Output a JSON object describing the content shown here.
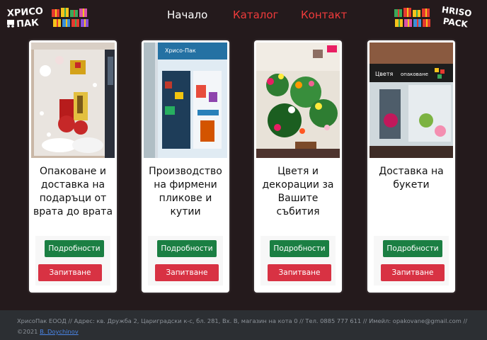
{
  "header": {
    "logo_left_text": [
      "ХРИСО",
      "ПАК"
    ],
    "logo_right_text": [
      "HRISO",
      "PACK"
    ],
    "nav": {
      "home": "Начало",
      "catalog": "Каталог",
      "contact": "Контакт"
    },
    "colors": {
      "active": "#ffffff",
      "link": "#ef3b3b"
    }
  },
  "cards": [
    {
      "title": "Опаковане и доставка на подаръци от врата до врата",
      "photo_icon": "gift-shop-window-photo",
      "more_label": "Подробности",
      "ask_label": "Запитване"
    },
    {
      "title": "Производство на фирмени пликове и кутии",
      "photo_icon": "store-front-photo",
      "more_label": "Подробности",
      "ask_label": "Запитване"
    },
    {
      "title": "Цветя и декорации за Вашите събития",
      "photo_icon": "flowers-photo",
      "more_label": "Подробности",
      "ask_label": "Запитване"
    },
    {
      "title": "Доставка на букети",
      "photo_icon": "flower-shop-photo",
      "more_label": "Подробности",
      "ask_label": "Запитване"
    }
  ],
  "footer": {
    "address": "ХрисоПак ЕООД // Адрес: кв. Дружба 2, Цариградски к-с, бл. 281, Вх. В, магазин на кота 0 // Тел. 0885 777 611 // Имейл: opakovane@gmail.com //",
    "copyright": "©2021",
    "author": "B. Doychinov"
  },
  "colors": {
    "background": "#241a1c",
    "details_button": "#1b7f43",
    "inquiry_button": "#d83243",
    "footer_bg": "#2c2f33"
  }
}
